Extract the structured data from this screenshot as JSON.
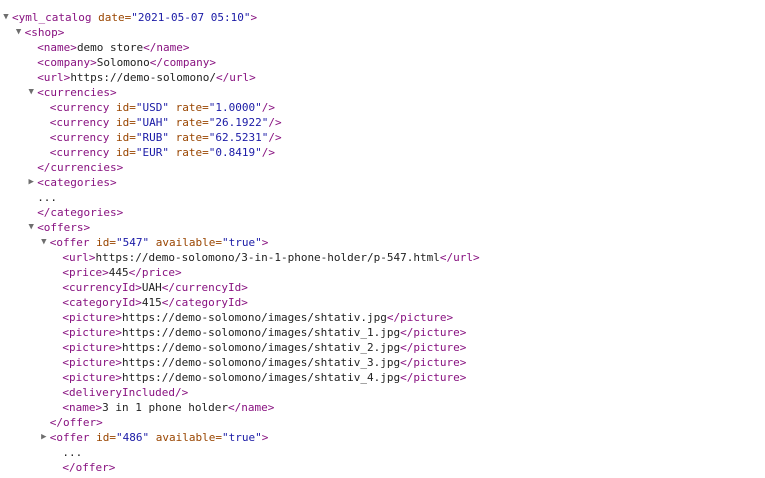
{
  "glyphs": {
    "expanded": "▼",
    "collapsed": "▶"
  },
  "lines": [
    {
      "indent": 0,
      "toggle": "expanded",
      "name": "yml-catalog-open",
      "parts": [
        [
          "tag",
          "<yml_catalog"
        ],
        [
          "txt",
          " "
        ],
        [
          "attr-name",
          "date="
        ],
        [
          "attr-val",
          "\"2021-05-07 05:10\""
        ],
        [
          "tag",
          ">"
        ]
      ]
    },
    {
      "indent": 1,
      "toggle": "expanded",
      "name": "shop-open",
      "parts": [
        [
          "tag",
          "<shop>"
        ]
      ]
    },
    {
      "indent": 2,
      "toggle": null,
      "name": "shop-name",
      "parts": [
        [
          "tag",
          "<name>"
        ],
        [
          "txt",
          "demo store"
        ],
        [
          "tag",
          "</name>"
        ]
      ]
    },
    {
      "indent": 2,
      "toggle": null,
      "name": "shop-company",
      "parts": [
        [
          "tag",
          "<company>"
        ],
        [
          "txt",
          "Solomono"
        ],
        [
          "tag",
          "</company>"
        ]
      ]
    },
    {
      "indent": 2,
      "toggle": null,
      "name": "shop-url",
      "parts": [
        [
          "tag",
          "<url>"
        ],
        [
          "txt",
          "https://demo-solomono/"
        ],
        [
          "tag",
          "</url>"
        ]
      ]
    },
    {
      "indent": 2,
      "toggle": "expanded",
      "name": "currencies-open",
      "parts": [
        [
          "tag",
          "<currencies>"
        ]
      ]
    },
    {
      "indent": 3,
      "toggle": null,
      "name": "currency-usd",
      "parts": [
        [
          "tag",
          "<currency"
        ],
        [
          "txt",
          " "
        ],
        [
          "attr-name",
          "id="
        ],
        [
          "attr-val",
          "\"USD\""
        ],
        [
          "txt",
          " "
        ],
        [
          "attr-name",
          "rate="
        ],
        [
          "attr-val",
          "\"1.0000\""
        ],
        [
          "tag",
          "/>"
        ]
      ]
    },
    {
      "indent": 3,
      "toggle": null,
      "name": "currency-uah",
      "parts": [
        [
          "tag",
          "<currency"
        ],
        [
          "txt",
          " "
        ],
        [
          "attr-name",
          "id="
        ],
        [
          "attr-val",
          "\"UAH\""
        ],
        [
          "txt",
          " "
        ],
        [
          "attr-name",
          "rate="
        ],
        [
          "attr-val",
          "\"26.1922\""
        ],
        [
          "tag",
          "/>"
        ]
      ]
    },
    {
      "indent": 3,
      "toggle": null,
      "name": "currency-rub",
      "parts": [
        [
          "tag",
          "<currency"
        ],
        [
          "txt",
          " "
        ],
        [
          "attr-name",
          "id="
        ],
        [
          "attr-val",
          "\"RUB\""
        ],
        [
          "txt",
          " "
        ],
        [
          "attr-name",
          "rate="
        ],
        [
          "attr-val",
          "\"62.5231\""
        ],
        [
          "tag",
          "/>"
        ]
      ]
    },
    {
      "indent": 3,
      "toggle": null,
      "name": "currency-eur",
      "parts": [
        [
          "tag",
          "<currency"
        ],
        [
          "txt",
          " "
        ],
        [
          "attr-name",
          "id="
        ],
        [
          "attr-val",
          "\"EUR\""
        ],
        [
          "txt",
          " "
        ],
        [
          "attr-name",
          "rate="
        ],
        [
          "attr-val",
          "\"0.8419\""
        ],
        [
          "tag",
          "/>"
        ]
      ]
    },
    {
      "indent": 2,
      "toggle": null,
      "name": "currencies-close",
      "parts": [
        [
          "tag",
          "</currencies>"
        ]
      ]
    },
    {
      "indent": 2,
      "toggle": "collapsed",
      "name": "categories-open",
      "parts": [
        [
          "tag",
          "<categories>"
        ]
      ]
    },
    {
      "indent": 2,
      "toggle": null,
      "name": "categories-ellipsis",
      "parts": [
        [
          "txt",
          "..."
        ]
      ]
    },
    {
      "indent": 2,
      "toggle": null,
      "name": "categories-close",
      "parts": [
        [
          "tag",
          "</categories>"
        ]
      ]
    },
    {
      "indent": 2,
      "toggle": "expanded",
      "name": "offers-open",
      "parts": [
        [
          "tag",
          "<offers>"
        ]
      ]
    },
    {
      "indent": 3,
      "toggle": "expanded",
      "name": "offer-547-open",
      "parts": [
        [
          "tag",
          "<offer"
        ],
        [
          "txt",
          " "
        ],
        [
          "attr-name",
          "id="
        ],
        [
          "attr-val",
          "\"547\""
        ],
        [
          "txt",
          " "
        ],
        [
          "attr-name",
          "available="
        ],
        [
          "attr-val",
          "\"true\""
        ],
        [
          "tag",
          ">"
        ]
      ]
    },
    {
      "indent": 4,
      "toggle": null,
      "name": "offer-url",
      "parts": [
        [
          "tag",
          "<url>"
        ],
        [
          "txt",
          "https://demo-solomono/3-in-1-phone-holder/p-547.html"
        ],
        [
          "tag",
          "</url>"
        ]
      ]
    },
    {
      "indent": 4,
      "toggle": null,
      "name": "offer-price",
      "parts": [
        [
          "tag",
          "<price>"
        ],
        [
          "txt",
          "445"
        ],
        [
          "tag",
          "</price>"
        ]
      ]
    },
    {
      "indent": 4,
      "toggle": null,
      "name": "offer-currency-id",
      "parts": [
        [
          "tag",
          "<currencyId>"
        ],
        [
          "txt",
          "UAH"
        ],
        [
          "tag",
          "</currencyId>"
        ]
      ]
    },
    {
      "indent": 4,
      "toggle": null,
      "name": "offer-category-id",
      "parts": [
        [
          "tag",
          "<categoryId>"
        ],
        [
          "txt",
          "415"
        ],
        [
          "tag",
          "</categoryId>"
        ]
      ]
    },
    {
      "indent": 4,
      "toggle": null,
      "name": "offer-picture-1",
      "parts": [
        [
          "tag",
          "<picture>"
        ],
        [
          "txt",
          "https://demo-solomono/images/shtativ.jpg"
        ],
        [
          "tag",
          "</picture>"
        ]
      ]
    },
    {
      "indent": 4,
      "toggle": null,
      "name": "offer-picture-2",
      "parts": [
        [
          "tag",
          "<picture>"
        ],
        [
          "txt",
          "https://demo-solomono/images/shtativ_1.jpg"
        ],
        [
          "tag",
          "</picture>"
        ]
      ]
    },
    {
      "indent": 4,
      "toggle": null,
      "name": "offer-picture-3",
      "parts": [
        [
          "tag",
          "<picture>"
        ],
        [
          "txt",
          "https://demo-solomono/images/shtativ_2.jpg"
        ],
        [
          "tag",
          "</picture>"
        ]
      ]
    },
    {
      "indent": 4,
      "toggle": null,
      "name": "offer-picture-4",
      "parts": [
        [
          "tag",
          "<picture>"
        ],
        [
          "txt",
          "https://demo-solomono/images/shtativ_3.jpg"
        ],
        [
          "tag",
          "</picture>"
        ]
      ]
    },
    {
      "indent": 4,
      "toggle": null,
      "name": "offer-picture-5",
      "parts": [
        [
          "tag",
          "<picture>"
        ],
        [
          "txt",
          "https://demo-solomono/images/shtativ_4.jpg"
        ],
        [
          "tag",
          "</picture>"
        ]
      ]
    },
    {
      "indent": 4,
      "toggle": null,
      "name": "offer-delivery-included",
      "parts": [
        [
          "tag",
          "<deliveryIncluded/>"
        ]
      ]
    },
    {
      "indent": 4,
      "toggle": null,
      "name": "offer-name",
      "parts": [
        [
          "tag",
          "<name>"
        ],
        [
          "txt",
          "3 in 1 phone holder"
        ],
        [
          "tag",
          "</name>"
        ]
      ]
    },
    {
      "indent": 3,
      "toggle": null,
      "name": "offer-547-close",
      "parts": [
        [
          "tag",
          "</offer>"
        ]
      ]
    },
    {
      "indent": 3,
      "toggle": "collapsed",
      "name": "offer-486-open",
      "parts": [
        [
          "tag",
          "<offer"
        ],
        [
          "txt",
          " "
        ],
        [
          "attr-name",
          "id="
        ],
        [
          "attr-val",
          "\"486\""
        ],
        [
          "txt",
          " "
        ],
        [
          "attr-name",
          "available="
        ],
        [
          "attr-val",
          "\"true\""
        ],
        [
          "tag",
          ">"
        ]
      ]
    },
    {
      "indent": 4,
      "toggle": null,
      "name": "offer-486-ellipsis",
      "parts": [
        [
          "txt",
          "..."
        ]
      ]
    },
    {
      "indent": 4,
      "toggle": null,
      "name": "offer-486-close",
      "parts": [
        [
          "tag",
          "</offer>"
        ]
      ]
    }
  ]
}
